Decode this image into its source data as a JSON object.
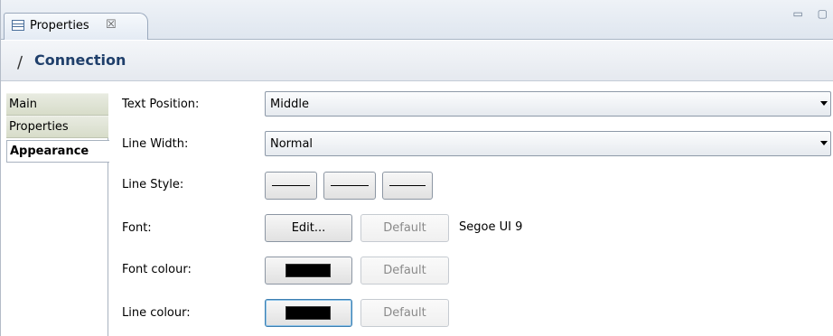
{
  "tab": {
    "label": "Properties",
    "close_glyph": "☒",
    "icon": "properties-view-icon"
  },
  "window_controls": {
    "glyph": "▭ ▢"
  },
  "header": {
    "icon_glyph": "∕",
    "icon": "connection-line-icon",
    "title": "Connection"
  },
  "side_tabs": [
    {
      "label": "Main"
    },
    {
      "label": "Properties"
    },
    {
      "label": "Appearance",
      "active": true
    }
  ],
  "appearance": {
    "text_position": {
      "label": "Text Position:",
      "value": "Middle"
    },
    "line_width": {
      "label": "Line Width:",
      "value": "Normal"
    },
    "line_style": {
      "label": "Line Style:"
    },
    "font": {
      "label": "Font:",
      "edit_label": "Edit...",
      "default_label": "Default",
      "current": "Segoe UI 9"
    },
    "font_colour": {
      "label": "Font colour:",
      "default_label": "Default",
      "color": "#000000"
    },
    "line_colour": {
      "label": "Line colour:",
      "default_label": "Default",
      "color": "#000000"
    }
  }
}
